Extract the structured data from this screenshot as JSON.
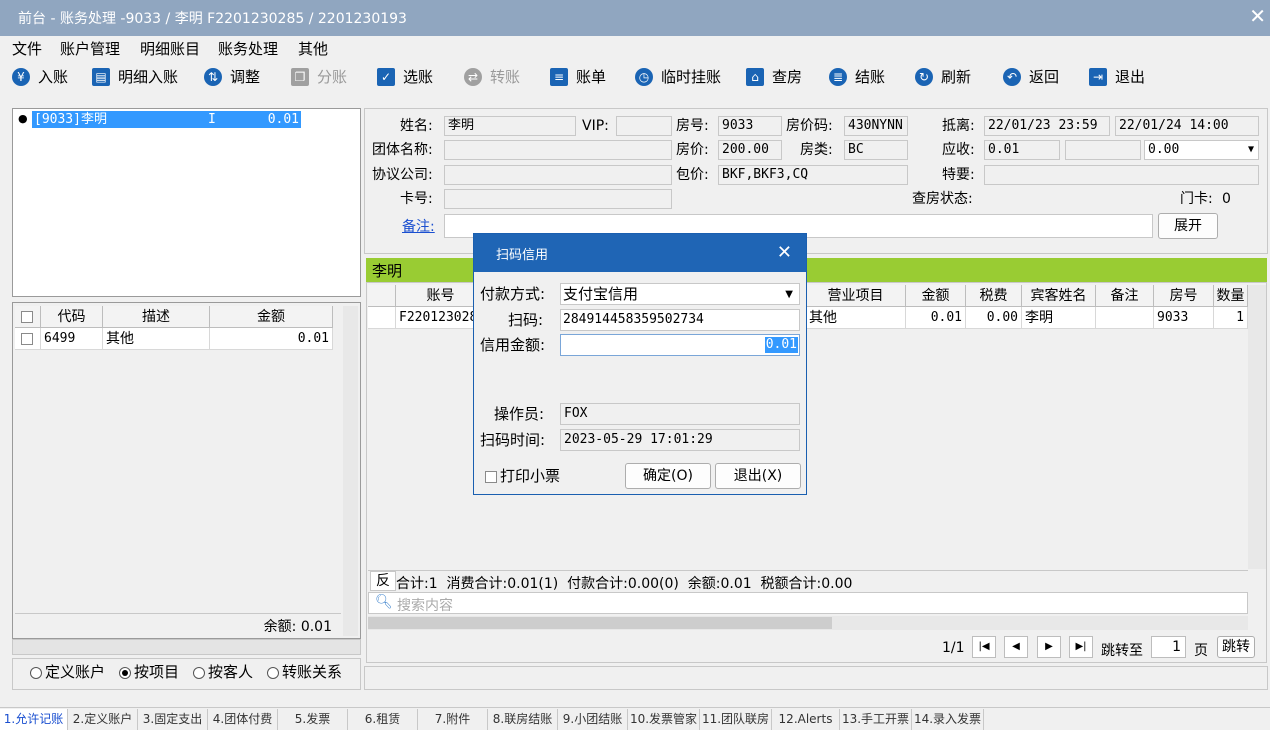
{
  "title": "前台 - 账务处理 -9033 / 李明 F2201230285 / 2201230193",
  "menu": [
    "文件",
    "账户管理",
    "明细账目",
    "账务处理",
    "其他"
  ],
  "toolbar": [
    {
      "label": "入账",
      "icon": "yen-icon",
      "enabled": true
    },
    {
      "label": "明细入账",
      "icon": "printer-icon",
      "enabled": true
    },
    {
      "label": "调整",
      "icon": "adjust-icon",
      "enabled": true
    },
    {
      "label": "分账",
      "icon": "split-icon",
      "enabled": false
    },
    {
      "label": "选账",
      "icon": "select-check-icon",
      "enabled": true
    },
    {
      "label": "转账",
      "icon": "transfer-icon",
      "enabled": false
    },
    {
      "label": "账单",
      "icon": "bill-icon",
      "enabled": true
    },
    {
      "label": "临时挂账",
      "icon": "clock-icon",
      "enabled": true
    },
    {
      "label": "查房",
      "icon": "house-icon",
      "enabled": true
    },
    {
      "label": "结账",
      "icon": "database-icon",
      "enabled": true
    },
    {
      "label": "刷新",
      "icon": "refresh-icon",
      "enabled": true
    },
    {
      "label": "返回",
      "icon": "undo-icon",
      "enabled": true
    },
    {
      "label": "退出",
      "icon": "exit-icon",
      "enabled": true
    }
  ],
  "tree": {
    "item": "[9033]李明",
    "flag": "I",
    "amount": "0.01"
  },
  "left_table": {
    "headers": [
      "代码",
      "描述",
      "金额"
    ],
    "rows": [
      {
        "code": "6499",
        "desc": "其他",
        "amount": "0.01"
      }
    ],
    "balance": "余额: 0.01"
  },
  "radios": [
    {
      "label": "定义账户",
      "checked": false
    },
    {
      "label": "按项目",
      "checked": true
    },
    {
      "label": "按客人",
      "checked": false
    },
    {
      "label": "转账关系",
      "checked": false
    }
  ],
  "guest": {
    "name_label": "姓名:",
    "name": "李明",
    "vip_label": "VIP:",
    "vip": "",
    "room_label": "房号:",
    "room": "9033",
    "ratecode_label": "房价码:",
    "ratecode": "430NYNN",
    "arrdep_label": "抵离:",
    "arrival": "22/01/23 23:59",
    "departure": "22/01/24 14:00",
    "group_label": "团体名称:",
    "group": "",
    "rate_label": "房价:",
    "rate": "200.00",
    "roomtype_label": "房类:",
    "roomtype": "BC",
    "receivable_label": "应收:",
    "receivable": "0.01",
    "receivable2": "",
    "receivable3": "0.00",
    "company_label": "协议公司:",
    "company": "",
    "package_label": "包价:",
    "package": "BKF,BKF3,CQ",
    "special_label": "特要:",
    "special": "",
    "card_label": "卡号:",
    "card": "",
    "checkstatus_label": "查房状态:",
    "doorcard_label": "门卡:",
    "doorcard": "0",
    "remark_label": "备注:",
    "remark": "",
    "expand_label": "展开"
  },
  "account_header": "李明",
  "main_table": {
    "headers": [
      "账号",
      "营业项目",
      "金额",
      "税费",
      "宾客姓名",
      "备注",
      "房号",
      "数量"
    ],
    "row": {
      "account": "F2201230285",
      "item": "其他",
      "amount": "0.01",
      "tax": "0.00",
      "guest": "李明",
      "remark": "",
      "room": "9033",
      "qty": "1"
    }
  },
  "summary": {
    "reverse": "反",
    "text": "合计:1  消费合计:0.01(1)  付款合计:0.00(0)  余额:0.01  税额合计:0.00"
  },
  "search": {
    "placeholder": "搜索内容"
  },
  "pager": {
    "page": "1/1",
    "goto_label": "跳转至",
    "goto_value": "1",
    "page_unit": "页",
    "jump": "跳转"
  },
  "dialog": {
    "title": "扫码信用",
    "paymethod_label": "付款方式:",
    "paymethod": "支付宝信用",
    "scan_label": "扫码:",
    "scan": "284914458359502734",
    "credit_label": "信用金额:",
    "credit": "0.01",
    "operator_label": "操作员:",
    "operator": "FOX",
    "scantime_label": "扫码时间:",
    "scantime": "2023-05-29 17:01:29",
    "print_label": "打印小票",
    "ok_label": "确定(O)",
    "cancel_label": "退出(X)"
  },
  "tabs": [
    "1.允许记账",
    "2.定义账户",
    "3.固定支出",
    "4.团体付费",
    "5.发票",
    "6.租赁",
    "7.附件",
    "8.联房结账",
    "9.小团结账",
    "10.发票管家",
    "11.团队联房",
    "12.Alerts",
    "13.手工开票",
    "14.录入发票"
  ],
  "colors": {
    "title_bar": "#90a6c0",
    "dialog_title": "#1f65b5",
    "account_header": "#99cc33",
    "selection": "#3399ff",
    "active_tab_text": "#1a4fd0"
  }
}
